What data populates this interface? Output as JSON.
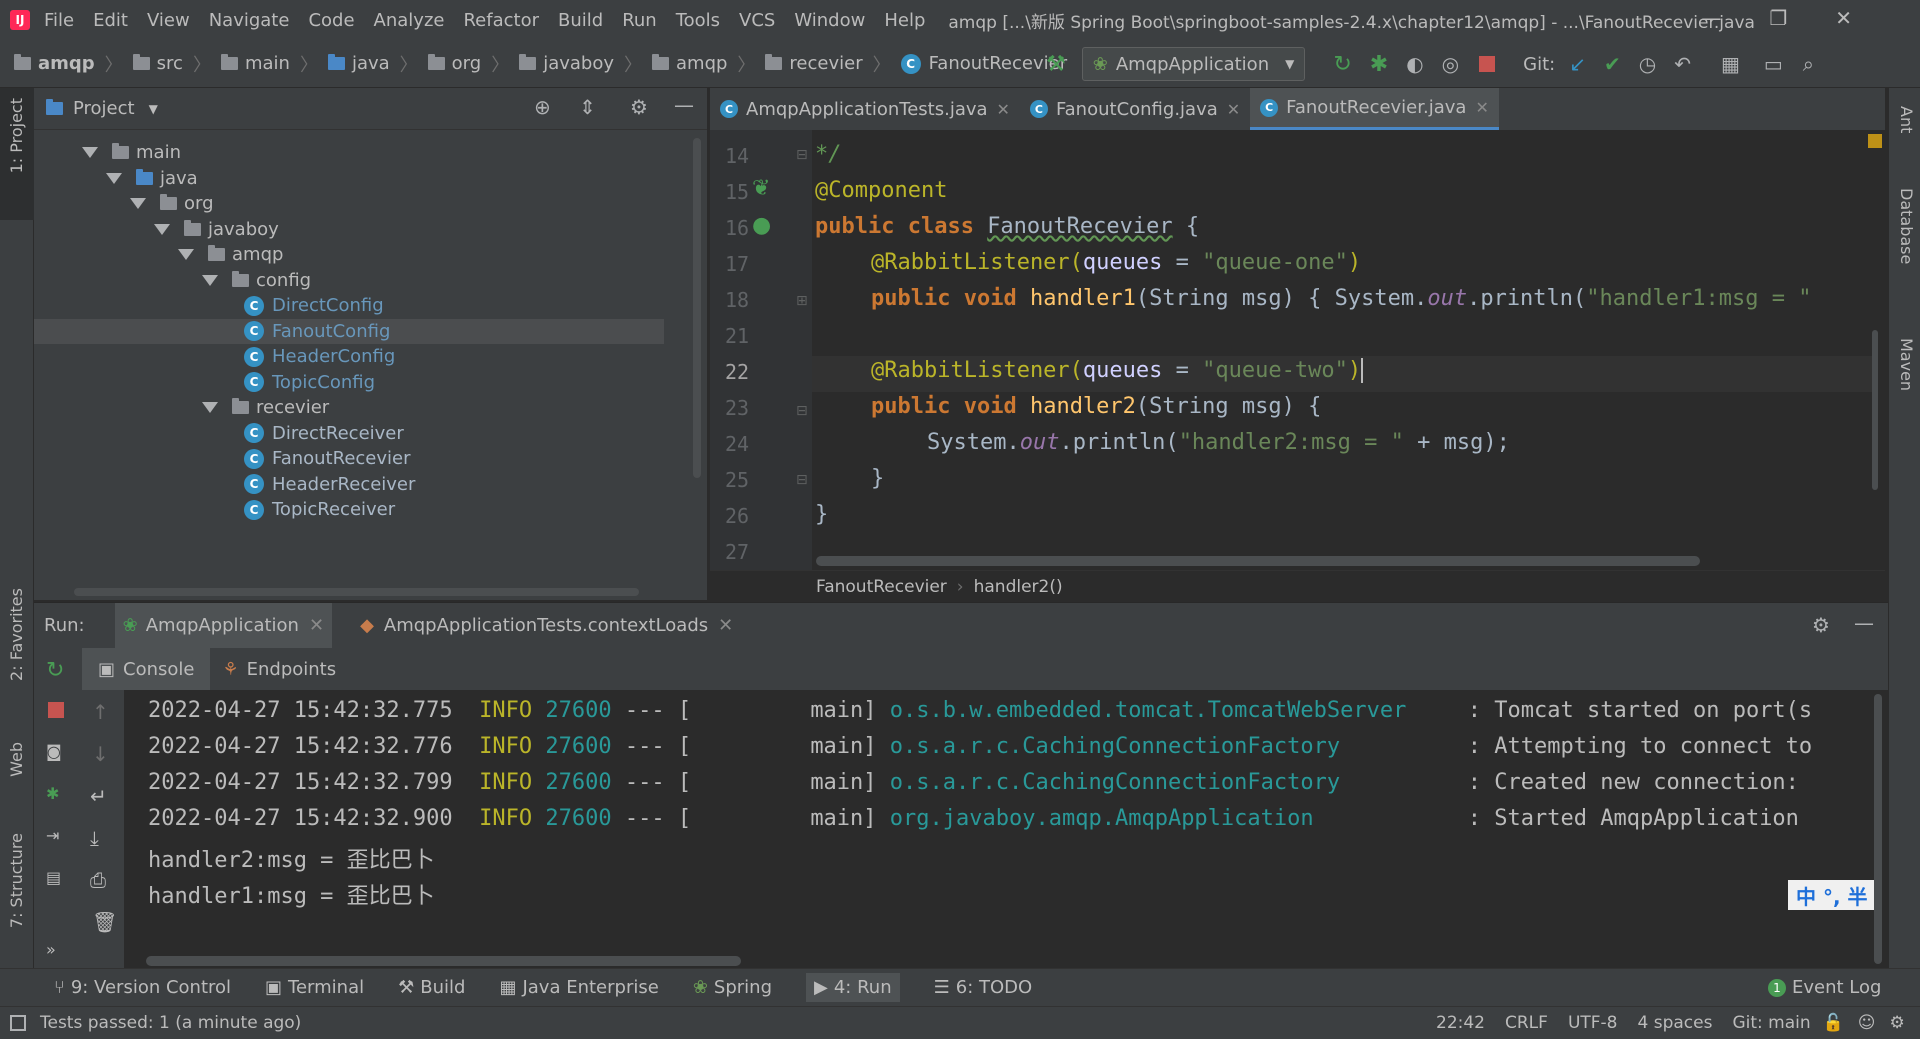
{
  "menubar": {
    "items": [
      "File",
      "Edit",
      "View",
      "Navigate",
      "Code",
      "Analyze",
      "Refactor",
      "Build",
      "Run",
      "Tools",
      "VCS",
      "Window",
      "Help"
    ],
    "title": "amqp [...\\新版 Spring Boot\\springboot-samples-2.4.x\\chapter12\\amqp] - ...\\FanoutRecevier.java"
  },
  "navbar": {
    "crumbs": [
      "amqp",
      "src",
      "main",
      "java",
      "org",
      "javaboy",
      "amqp",
      "recevier",
      "FanoutRecevier"
    ],
    "run_config": "AmqpApplication",
    "git_label": "Git:"
  },
  "left_tabs": {
    "project": "1: Project",
    "favorites": "2: Favorites",
    "web": "Web",
    "structure": "7: Structure"
  },
  "right_tabs": {
    "ant": "Ant",
    "database": "Database",
    "maven": "Maven"
  },
  "project": {
    "title": "Project",
    "tree": [
      {
        "label": "main",
        "type": "folder"
      },
      {
        "label": "java",
        "type": "folder-blue"
      },
      {
        "label": "org",
        "type": "folder"
      },
      {
        "label": "javaboy",
        "type": "folder"
      },
      {
        "label": "amqp",
        "type": "folder"
      },
      {
        "label": "config",
        "type": "folder"
      },
      {
        "label": "DirectConfig",
        "type": "class"
      },
      {
        "label": "FanoutConfig",
        "type": "class"
      },
      {
        "label": "HeaderConfig",
        "type": "class"
      },
      {
        "label": "TopicConfig",
        "type": "class"
      },
      {
        "label": "recevier",
        "type": "folder"
      },
      {
        "label": "DirectReceiver",
        "type": "class"
      },
      {
        "label": "FanoutRecevier",
        "type": "class"
      },
      {
        "label": "HeaderReceiver",
        "type": "class"
      },
      {
        "label": "TopicReceiver",
        "type": "class"
      }
    ]
  },
  "editor": {
    "tabs": [
      "AmqpApplicationTests.java",
      "FanoutConfig.java",
      "FanoutRecevier.java"
    ],
    "line_numbers": [
      "14",
      "15",
      "16",
      "17",
      "18",
      "21",
      "22",
      "23",
      "24",
      "25",
      "26",
      "27"
    ],
    "code": {
      "l14": "*/",
      "l15": "@Component",
      "l16a": "public class ",
      "l16b": "FanoutRecevier",
      " l16c": " {",
      "l17a": "@RabbitListener(",
      "l17b": "queues",
      " l17c": " = ",
      "l17d": "\"queue-one\"",
      "l17e": ")",
      "l18a": "public void ",
      "l18b": "handler1",
      "l18c": "(String msg) { System.",
      "l18d": "out",
      "l18e": ".println(",
      "l18f": "\"handler1:msg = \"",
      "l22a": "@RabbitListener(",
      "l22b": "queues",
      "l22c": " = ",
      "l22d": "\"queue-two\"",
      "l22e": ")",
      "l23a": "public void ",
      "l23b": "handler2",
      "l23c": "(String msg) {",
      "l24a": "System.",
      "l24b": "out",
      "l24c": ".println(",
      "l24d": "\"handler2:msg = \"",
      "l24e": " + msg);",
      "l25": "}",
      "l26": "}"
    },
    "breadcrumb": [
      "FanoutRecevier",
      "handler2()"
    ]
  },
  "run": {
    "label": "Run:",
    "tabs": [
      "AmqpApplication",
      "AmqpApplicationTests.contextLoads"
    ],
    "subtabs": [
      "Console",
      "Endpoints"
    ],
    "console": [
      {
        "ts": "2022-04-27 15:42:32.775",
        "lvl": "INFO",
        "pid": "27600",
        "sep": "--- [",
        "thread": "main]",
        "logger": "o.s.b.w.embedded.tomcat.TomcatWebServer",
        "msg": ": Tomcat started on port(s"
      },
      {
        "ts": "2022-04-27 15:42:32.776",
        "lvl": "INFO",
        "pid": "27600",
        "sep": "--- [",
        "thread": "main]",
        "logger": "o.s.a.r.c.CachingConnectionFactory",
        "msg": ": Attempting to connect to"
      },
      {
        "ts": "2022-04-27 15:42:32.799",
        "lvl": "INFO",
        "pid": "27600",
        "sep": "--- [",
        "thread": "main]",
        "logger": "o.s.a.r.c.CachingConnectionFactory",
        "msg": ": Created new connection:"
      },
      {
        "ts": "2022-04-27 15:42:32.900",
        "lvl": "INFO",
        "pid": "27600",
        "sep": "--- [",
        "thread": "main]",
        "logger": "org.javaboy.amqp.AmqpApplication",
        "msg": ": Started AmqpApplication"
      }
    ],
    "output": [
      "handler2:msg = 歪比巴卜",
      "handler1:msg = 歪比巴卜"
    ],
    "ime": "中 °, 半"
  },
  "bottom_tabs": [
    "9: Version Control",
    "Terminal",
    "Build",
    "Java Enterprise",
    "Spring",
    "4: Run",
    "6: TODO"
  ],
  "event_log": {
    "badge": "1",
    "label": "Event Log"
  },
  "status": {
    "message": "Tests passed: 1 (a minute ago)",
    "position": "22:42",
    "line_sep": "CRLF",
    "encoding": "UTF-8",
    "indent": "4 spaces",
    "git": "Git: main"
  }
}
